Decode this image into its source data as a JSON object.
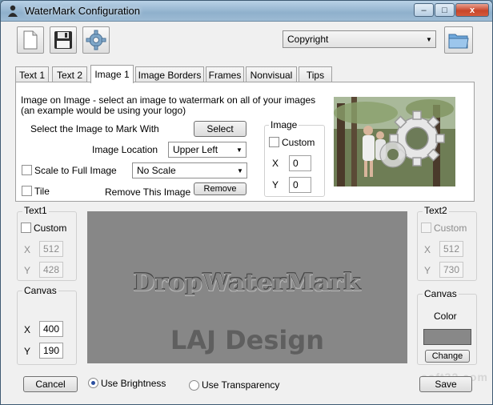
{
  "window": {
    "title": "WaterMark Configuration",
    "minimize_glyph": "–",
    "maximize_glyph": "□",
    "close_glyph": "x"
  },
  "toolbar": {
    "new_icon": "new-document-icon",
    "save_icon": "floppy-disk-icon",
    "settings_icon": "gear-icon",
    "preset_value": "Copyright",
    "open_icon": "folder-icon"
  },
  "tabs": [
    {
      "label": "Text 1"
    },
    {
      "label": "Text 2"
    },
    {
      "label": "Image 1"
    },
    {
      "label": "Image Borders"
    },
    {
      "label": "Frames"
    },
    {
      "label": "Nonvisual"
    },
    {
      "label": "Tips"
    }
  ],
  "image_tab": {
    "description_line1": "Image on Image - select an image to watermark on all of your images",
    "description_line2": "(an example would be using your logo)",
    "select_label": "Select the Image to Mark With",
    "select_button": "Select",
    "location_label": "Image Location",
    "location_value": "Upper Left",
    "scale_label": "Scale to Full Image",
    "scale_value": "No Scale",
    "tile_label": "Tile",
    "remove_label": "Remove This Image",
    "remove_button": "Remove",
    "image_group": {
      "title": "Image",
      "custom_label": "Custom",
      "x_label": "X",
      "x_value": "0",
      "y_label": "Y",
      "y_value": "0"
    }
  },
  "text1_group": {
    "title": "Text1",
    "custom_label": "Custom",
    "x_label": "X",
    "x_value": "512",
    "y_label": "Y",
    "y_value": "428"
  },
  "text2_group": {
    "title": "Text2",
    "custom_label": "Custom",
    "x_label": "X",
    "x_value": "512",
    "y_label": "Y",
    "y_value": "730"
  },
  "canvas_group": {
    "title": "Canvas",
    "x_label": "X",
    "x_value": "400",
    "y_label": "Y",
    "y_value": "190"
  },
  "canvas_color_group": {
    "title": "Canvas",
    "color_label": "Color",
    "change_button": "Change",
    "swatch_color": "#888888"
  },
  "preview": {
    "watermark_text1": "DropWaterMark",
    "watermark_text2": "LAJ Design",
    "background_color": "#878787"
  },
  "footer": {
    "cancel_button": "Cancel",
    "brightness_label": "Use Brightness",
    "transparency_label": "Use Transparency",
    "save_button": "Save"
  },
  "site_watermark": "soft32.com"
}
